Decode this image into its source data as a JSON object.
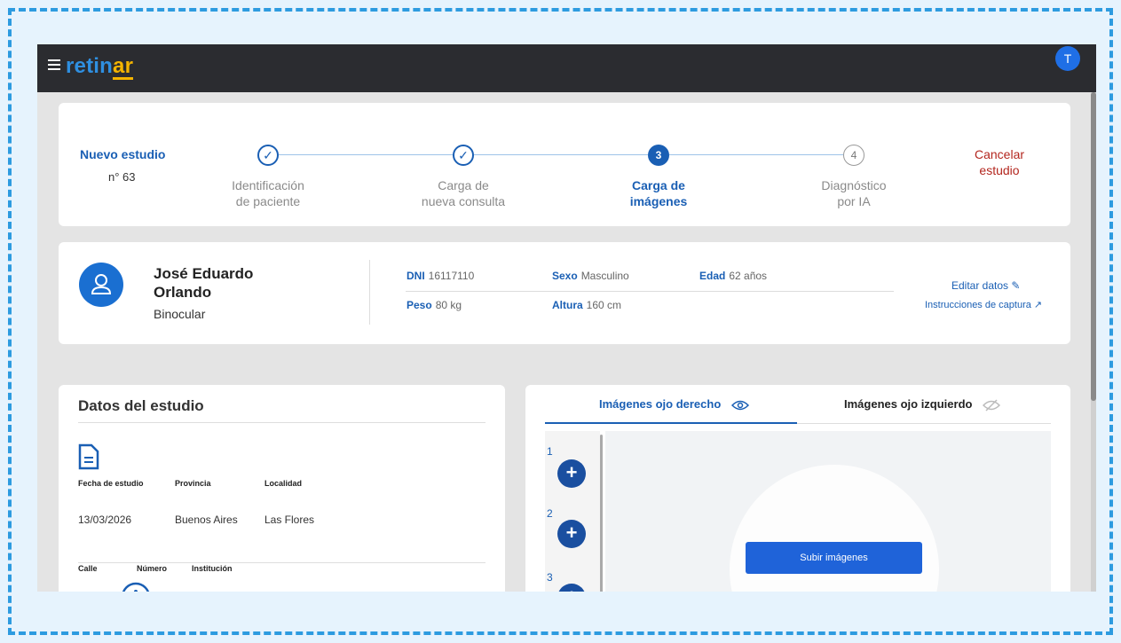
{
  "app": {
    "logo_main": "retin",
    "logo_accent": "ar",
    "user_initial": "T"
  },
  "stepper": {
    "title": "Nuevo estudio",
    "number": "n° 63",
    "steps": [
      {
        "num": "✓",
        "line1": "Identificación",
        "line2": "de paciente",
        "status": "done"
      },
      {
        "num": "✓",
        "line1": "Carga de",
        "line2": "nueva consulta",
        "status": "done"
      },
      {
        "num": "3",
        "line1": "Carga de",
        "line2": "imágenes",
        "status": "active"
      },
      {
        "num": "4",
        "line1": "Diagnóstico",
        "line2": "por IA",
        "status": "pending"
      }
    ],
    "cancel_line1": "Cancelar",
    "cancel_line2": "estudio"
  },
  "patient": {
    "name_line1": "José Eduardo",
    "name_line2": "Orlando",
    "type": "Binocular",
    "dni_label": "DNI",
    "dni": "16117110",
    "sexo_label": "Sexo",
    "sexo": "Masculino",
    "edad_label": "Edad",
    "edad": "62 años",
    "peso_label": "Peso",
    "peso": "80 kg",
    "altura_label": "Altura",
    "altura": "160 cm",
    "edit_label": "Editar datos",
    "instructions_label": "Instrucciones de captura"
  },
  "datos": {
    "title": "Datos del estudio",
    "fecha_label": "Fecha de estudio",
    "provincia_label": "Provincia",
    "localidad_label": "Localidad",
    "fecha": "13/03/2026",
    "provincia": "Buenos Aires",
    "localidad": "Las Flores",
    "calle_label": "Calle",
    "numero_label": "Número",
    "institucion_label": "Institución"
  },
  "images": {
    "tab_right_eye": "Imágenes ojo derecho",
    "tab_left_eye": "Imágenes ojo izquierdo",
    "slots": [
      "1",
      "2",
      "3"
    ],
    "add_symbol": "+",
    "upload_label": "Subir imágenes"
  },
  "colors": {
    "primary": "#1a5fb4",
    "topbar": "#2b2c30",
    "accent": "#f4b400",
    "danger": "#b3261e",
    "upload": "#1f63d9"
  }
}
